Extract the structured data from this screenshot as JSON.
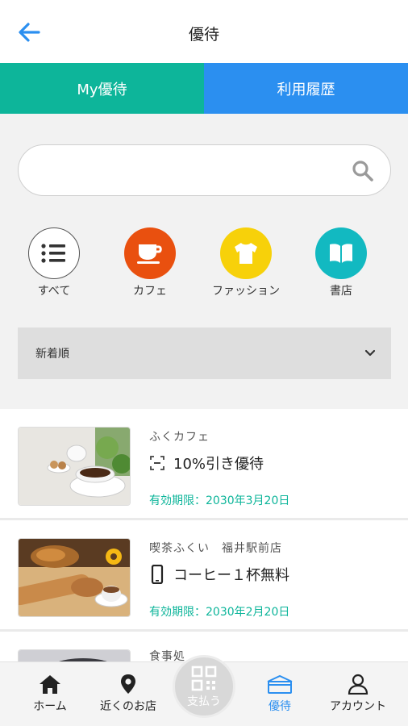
{
  "header": {
    "title": "優待",
    "back_icon": "arrow-left-icon"
  },
  "tabs": [
    {
      "label": "My優待"
    },
    {
      "label": "利用履歴"
    }
  ],
  "search": {
    "placeholder": "",
    "icon": "search-icon"
  },
  "categories": [
    {
      "label": "すべて",
      "icon": "list-icon",
      "color": "#ffffff"
    },
    {
      "label": "カフェ",
      "icon": "coffee-cup-icon",
      "color": "#e9500f"
    },
    {
      "label": "ファッション",
      "icon": "tshirt-icon",
      "color": "#f7d10a"
    },
    {
      "label": "書店",
      "icon": "book-icon",
      "color": "#12b9c1"
    }
  ],
  "sort": {
    "selected": "新着順"
  },
  "coupons": [
    {
      "shop": "ふくカフェ",
      "offer": "10%引き優待",
      "offer_icon": "scan-icon",
      "expiry": "有効期限：2030年3月20日"
    },
    {
      "shop": "喫茶ふくい　福井駅前店",
      "offer": "コーヒー１杯無料",
      "offer_icon": "phone-icon",
      "expiry": "有効期限：2030年2月20日"
    },
    {
      "shop": "食事処"
    }
  ],
  "bottom_nav": {
    "home": "ホーム",
    "nearby": "近くのお店",
    "pay": "支払う",
    "benefits": "優待",
    "account": "アカウント"
  },
  "colors": {
    "accent_green": "#0db59a",
    "accent_blue": "#2b8ff0"
  }
}
